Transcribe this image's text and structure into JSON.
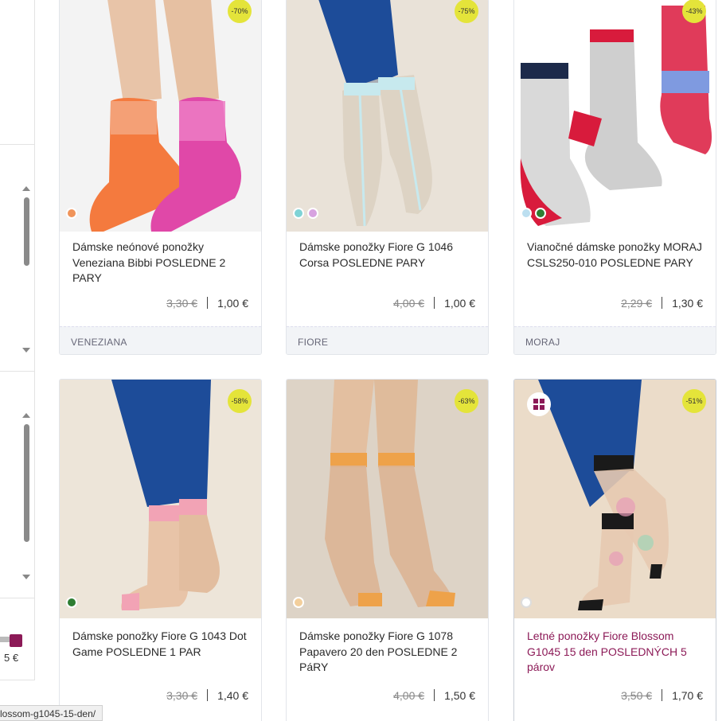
{
  "sidebar": {
    "price_value": "5 €"
  },
  "products": [
    {
      "title": "Dámske neónové ponožky Veneziana Bibbi POSLEDNE 2 PARY",
      "old_price": "3,30 €",
      "price": "1,00 €",
      "brand": "VENEZIANA",
      "discount": "-70%",
      "colors": [
        "#f0945a"
      ]
    },
    {
      "title": "Dámske ponožky Fiore G 1046 Corsa POSLEDNE PARY",
      "old_price": "4,00 €",
      "price": "1,00 €",
      "brand": "FIORE",
      "discount": "-75%",
      "colors": [
        "#7fd3d6",
        "#d7a2e0"
      ]
    },
    {
      "title": "Vianočné dámske ponožky MORAJ CSLS250-010 POSLEDNE PARY",
      "old_price": "2,29 €",
      "price": "1,30 €",
      "brand": "MORAJ",
      "discount": "-43%",
      "colors": [
        "#bcdff0",
        "#2e7d32"
      ]
    },
    {
      "title": "Dámske ponožky Fiore G 1043 Dot Game POSLEDNE 1 PAR",
      "old_price": "3,30 €",
      "price": "1,40 €",
      "discount": "-58%",
      "colors": [
        "#2e7d32"
      ]
    },
    {
      "title": "Dámske ponožky Fiore G 1078 Papavero 20 den POSLEDNE 2 PáRY",
      "old_price": "4,00 €",
      "price": "1,50 €",
      "discount": "-63%",
      "colors": [
        "#f3cf9c"
      ]
    },
    {
      "title": "Letné ponožky Fiore Blossom G1045 15 den POSLEDNÝCH 5 párov",
      "old_price": "3,50 €",
      "price": "1,70 €",
      "discount": "-51%",
      "colors": [
        "#ffffff"
      ]
    }
  ],
  "status_bar": {
    "url": "lossom-g1045-15-den/"
  },
  "colors": {
    "accent": "#8c1a57",
    "badge": "#e4e43a"
  }
}
